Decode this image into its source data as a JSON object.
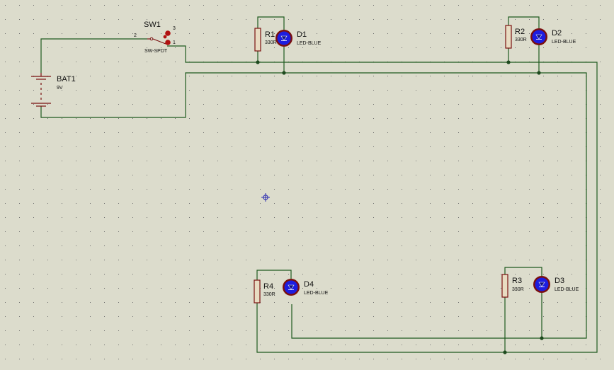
{
  "colors": {
    "background": "#dcdccc",
    "grid_dot": "#6e6e6e",
    "wire": "#1e5a1e",
    "component_body": "#7a1010",
    "resistor_fill": "#e8dcc2",
    "led_fill": "#1d1de0",
    "led_ring": "#7a1010",
    "junction": "#1e4a1e",
    "switch_contact": "#b01010",
    "origin_marker": "#2a2ab0",
    "text": "#111111"
  },
  "battery": {
    "ref": "BAT1",
    "value": "9V"
  },
  "switch": {
    "ref": "SW1",
    "type": "SW-SPDT",
    "pin_common": "2",
    "pin_a": "3",
    "pin_b": "1"
  },
  "resistors": [
    {
      "ref": "R1",
      "value": "330R"
    },
    {
      "ref": "R2",
      "value": "330R"
    },
    {
      "ref": "R3",
      "value": "330R"
    },
    {
      "ref": "R4",
      "value": "330R"
    }
  ],
  "leds": [
    {
      "ref": "D1",
      "value": "LED-BLUE"
    },
    {
      "ref": "D2",
      "value": "LED-BLUE"
    },
    {
      "ref": "D3",
      "value": "LED-BLUE"
    },
    {
      "ref": "D4",
      "value": "LED-BLUE"
    }
  ],
  "icons": {
    "origin": "crosshair-origin-icon",
    "led": "led-icon",
    "resistor": "resistor-icon"
  }
}
